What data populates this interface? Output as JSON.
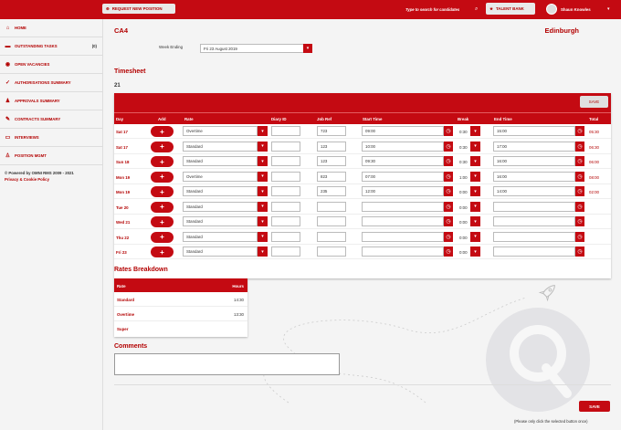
{
  "header": {
    "request_button": "REQUEST NEW POSITION",
    "search_placeholder": "Type to search for candidates",
    "talent_bank": "TALENT BANK",
    "user_name": "Shaun Knowles"
  },
  "sidebar": {
    "items": [
      {
        "label": "HOME",
        "icon": "home-icon",
        "glyph": "⌂"
      },
      {
        "label": "OUTSTANDING TASKS",
        "icon": "folder-icon",
        "glyph": "▬",
        "count": "(0)"
      },
      {
        "label": "OPEN VACANCIES",
        "icon": "user-circle-icon",
        "glyph": "◉"
      },
      {
        "label": "AUTHORISATIONS SUMMARY",
        "icon": "check-icon",
        "glyph": "✓"
      },
      {
        "label": "APPROVALS SUMMARY",
        "icon": "users-icon",
        "glyph": "♟"
      },
      {
        "label": "CONTRACTS SUMMARY",
        "icon": "pencil-icon",
        "glyph": "✎"
      },
      {
        "label": "INTERVIEWS",
        "icon": "chat-icon",
        "glyph": "▭"
      },
      {
        "label": "POSITION MGMT",
        "icon": "person-icon",
        "glyph": "♙"
      }
    ],
    "footer_powered": "© Powered by OMNI RMS 2009 - 2021",
    "footer_link": "Privacy & Cookie Policy"
  },
  "page": {
    "title": "CA4",
    "location": "Edinburgh",
    "week_label": "Week Ending",
    "week_value": "Fri 23 August 2019"
  },
  "timesheet": {
    "title": "Timesheet",
    "week_number": "21",
    "save_label": "SAVE",
    "columns": [
      "Day",
      "Add",
      "Rate",
      "Diary ID",
      "Job Ref",
      "Start Time",
      "Break",
      "End Time",
      "Total"
    ],
    "rows": [
      {
        "day": "Sat 17",
        "rate": "Overtime",
        "diary": "",
        "job": "723",
        "start": "09:00",
        "break": "0:30",
        "end": "15:00",
        "total": "05:30"
      },
      {
        "day": "Sat 17",
        "rate": "Standard",
        "diary": "",
        "job": "123",
        "start": "10:00",
        "break": "0:30",
        "end": "17:00",
        "total": "06:30"
      },
      {
        "day": "Sun 18",
        "rate": "Standard",
        "diary": "",
        "job": "123",
        "start": "09:30",
        "break": "0:30",
        "end": "16:00",
        "total": "06:00"
      },
      {
        "day": "Mon 19",
        "rate": "Overtime",
        "diary": "",
        "job": "823",
        "start": "07:00",
        "break": "1:00",
        "end": "16:00",
        "total": "08:00"
      },
      {
        "day": "Mon 19",
        "rate": "Standard",
        "diary": "",
        "job": "235",
        "start": "12:00",
        "break": "0:00",
        "end": "14:00",
        "total": "02:00"
      },
      {
        "day": "Tue 20",
        "rate": "Standard",
        "diary": "",
        "job": "",
        "start": "",
        "break": "0:00",
        "end": "",
        "total": ""
      },
      {
        "day": "Wed 21",
        "rate": "Standard",
        "diary": "",
        "job": "",
        "start": "",
        "break": "0:00",
        "end": "",
        "total": ""
      },
      {
        "day": "Thu 22",
        "rate": "Standard",
        "diary": "",
        "job": "",
        "start": "",
        "break": "0:00",
        "end": "",
        "total": ""
      },
      {
        "day": "Fri 23",
        "rate": "Standard",
        "diary": "",
        "job": "",
        "start": "",
        "break": "0:00",
        "end": "",
        "total": ""
      }
    ]
  },
  "rates": {
    "title": "Rates Breakdown",
    "col_rate": "Rate",
    "col_hours": "Hours",
    "rows": [
      {
        "rate": "Standard",
        "hours": "14:30"
      },
      {
        "rate": "Overtime",
        "hours": "13:30"
      },
      {
        "rate": "Super",
        "hours": ""
      }
    ]
  },
  "comments": {
    "title": "Comments",
    "value": ""
  },
  "footer": {
    "save_label": "SAVE",
    "note": "(Please only click the selected button once)"
  },
  "colors": {
    "brand_red": "#c40a12",
    "text_red": "#b30000"
  }
}
